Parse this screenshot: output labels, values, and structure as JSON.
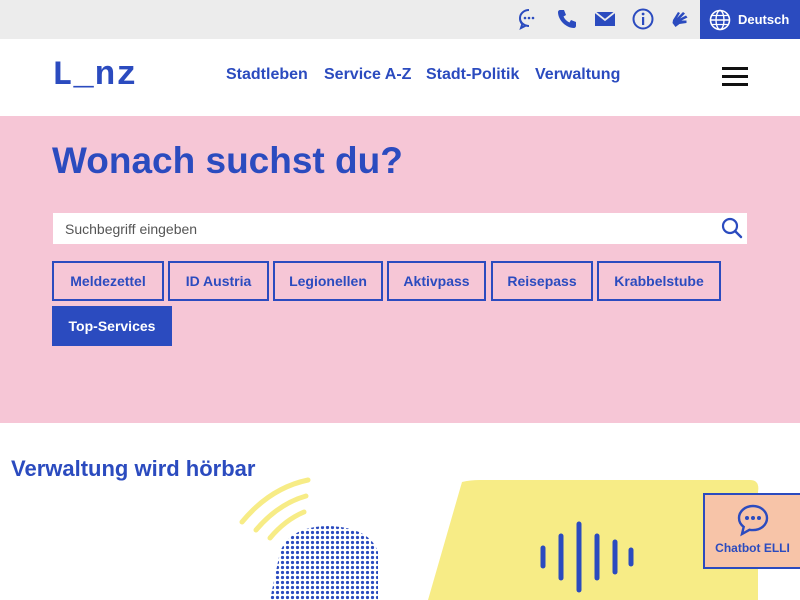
{
  "utility_bar": {
    "icons": [
      "chat-icon",
      "phone-icon",
      "mail-icon",
      "info-icon",
      "sign-language-icon"
    ],
    "language_label": "Deutsch"
  },
  "header": {
    "logo_text": "L_nz",
    "nav": [
      "Stadtleben",
      "Service A-Z",
      "Stadt-Politik",
      "Verwaltung"
    ]
  },
  "hero": {
    "title": "Wonach suchst du?",
    "search_placeholder": "Suchbegriff eingeben",
    "chips": [
      "Meldezettel",
      "ID Austria",
      "Legionellen",
      "Aktivpass",
      "Reisepass",
      "Krabbelstube",
      "Top-Services"
    ]
  },
  "section": {
    "title": "Verwaltung wird hörbar"
  },
  "chatbot": {
    "label": "Chatbot ELLI"
  },
  "colors": {
    "brand_blue": "#2b4bbf",
    "hero_pink": "#f6c6d6",
    "accent_yellow": "#f7ec86",
    "chatbot_peach": "#f7c4a8",
    "utility_gray": "#ececec"
  }
}
